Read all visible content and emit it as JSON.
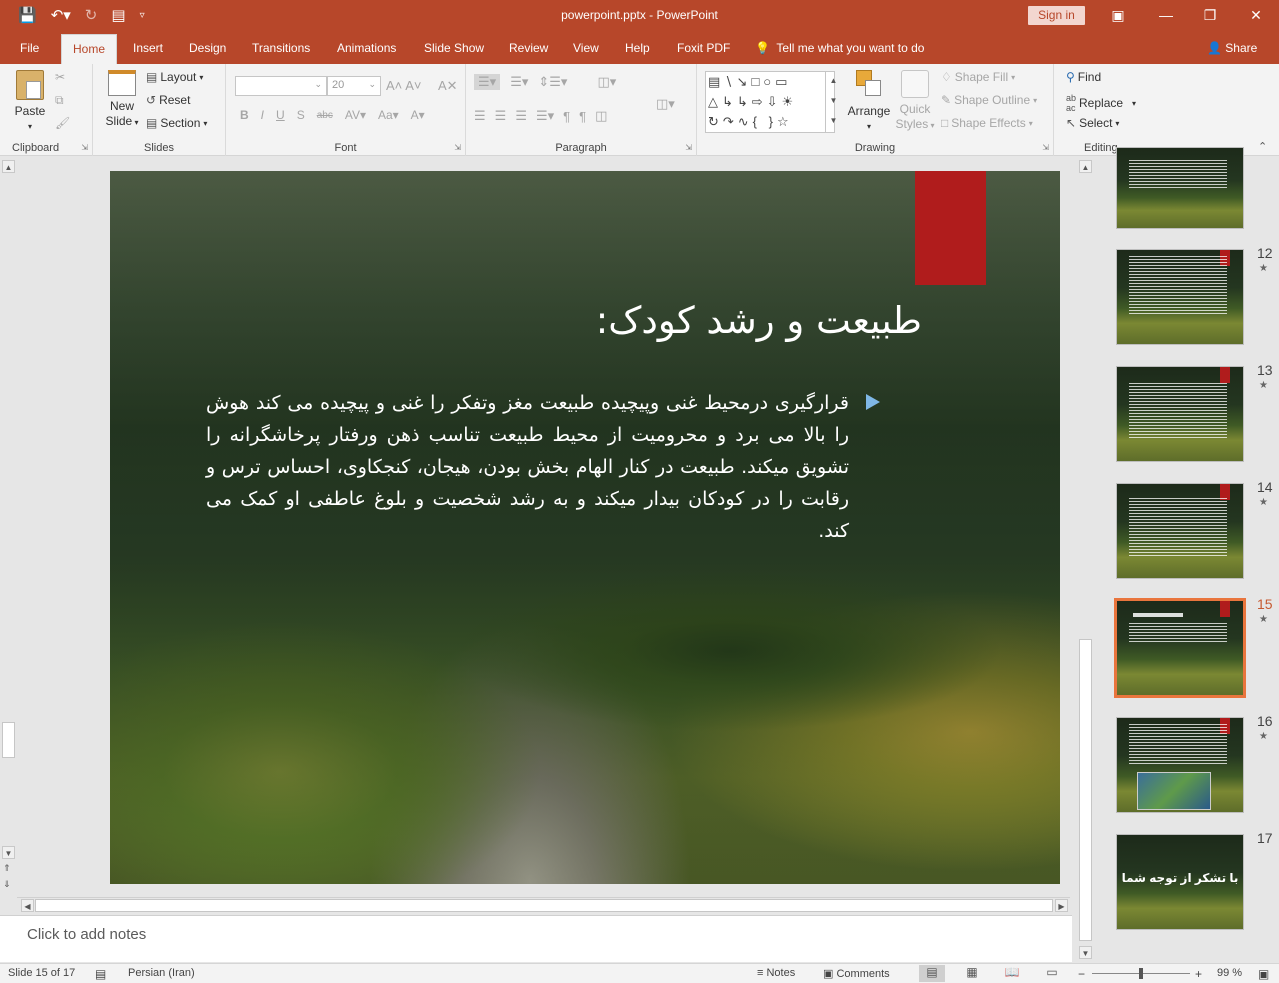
{
  "window": {
    "doc_title": "powerpoint.pptx  -  PowerPoint",
    "signin_label": "Sign in"
  },
  "tabs": [
    "File",
    "Home",
    "Insert",
    "Design",
    "Transitions",
    "Animations",
    "Slide Show",
    "Review",
    "View",
    "Help",
    "Foxit PDF"
  ],
  "active_tab": "Home",
  "tellme": "Tell me what you want to do",
  "share": "Share",
  "ribbon": {
    "clipboard": {
      "paste": "Paste",
      "label": "Clipboard"
    },
    "slides": {
      "new_slide_1": "New",
      "new_slide_2": "Slide",
      "layout": "Layout",
      "reset": "Reset",
      "section": "Section",
      "label": "Slides"
    },
    "font": {
      "label": "Font",
      "size_value": "20"
    },
    "paragraph": {
      "label": "Paragraph"
    },
    "drawing": {
      "arrange": "Arrange",
      "quick_styles_1": "Quick",
      "quick_styles_2": "Styles",
      "shape_fill": "Shape Fill",
      "shape_outline": "Shape Outline",
      "shape_effects": "Shape Effects",
      "label": "Drawing"
    },
    "editing": {
      "find": "Find",
      "replace": "Replace",
      "select": "Select",
      "label": "Editing"
    }
  },
  "slide": {
    "title": "طبیعت و رشد کودک:",
    "body": "قرارگیری درمحیط غنی وپیچیده طبیعت مغز وتفکر را غنی و پیچیده می کند هوش را بالا می برد و محرومیت از محیط طبیعت تناسب ذهن ورفتار پرخاشگرانه را تشویق میکند. طبیعت در کنار الهام بخش بودن، هیجان، کنجکاوی، احساس ترس و رقابت را در کودکان بیدار میکند و به رشد شخصیت و بلوغ عاطفی او کمک می کند."
  },
  "notes_placeholder": "Click to add notes",
  "thumbnails": [
    {
      "num": "12",
      "star": "★"
    },
    {
      "num": "13",
      "star": "★"
    },
    {
      "num": "14",
      "star": "★"
    },
    {
      "num": "15",
      "star": "★"
    },
    {
      "num": "16",
      "star": "★"
    },
    {
      "num": "17",
      "star": ""
    }
  ],
  "thumb_17_text": "با تشکر از توجه شما",
  "status": {
    "slide_info": "Slide 15 of 17",
    "language": "Persian (Iran)",
    "notes": "Notes",
    "comments": "Comments",
    "zoom": "99 %"
  },
  "colors": {
    "accent": "#b7472a",
    "slide_red": "#b01c1c",
    "selection": "#e9753d",
    "bullet": "#7fb7e6"
  }
}
